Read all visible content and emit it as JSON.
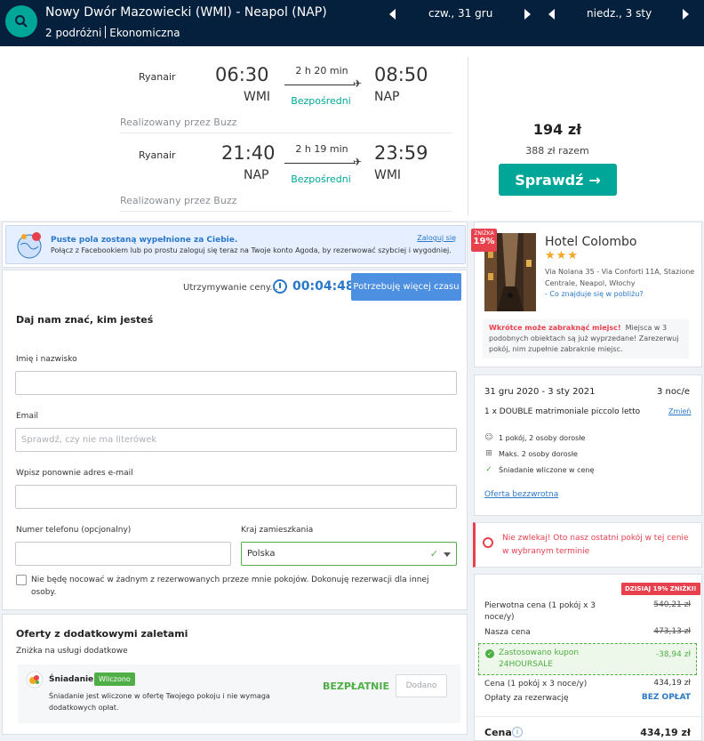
{
  "header": {
    "route": "Nowy Dwór Mazowiecki (WMI) - Neapol (NAP)",
    "travellers": "2 podróżni",
    "cabin": "Ekonomiczna",
    "outbound_date": "czw., 31 gru",
    "return_date": "niedz., 3 sty"
  },
  "flight": {
    "outbound": {
      "airline": "Ryanair",
      "dep_time": "06:30",
      "dep_code": "WMI",
      "duration": "2 h 20 min",
      "stops": "Bezpośredni",
      "arr_time": "08:50",
      "arr_code": "NAP",
      "operated_by": "Realizowany przez Buzz"
    },
    "inbound": {
      "airline": "Ryanair",
      "dep_time": "21:40",
      "dep_code": "NAP",
      "duration": "2 h 19 min",
      "stops": "Bezpośredni",
      "arr_time": "23:59",
      "arr_code": "WMI",
      "operated_by": "Realizowany przez Buzz"
    },
    "price": "194 zł",
    "price_total": "388 zł razem",
    "select_label": "Sprawdź"
  },
  "facebook": {
    "title": "Puste pola zostaną wypełnione za Ciebie.",
    "text": "Połącz z Facebookiem lub po prostu zaloguj się teraz na Twoje konto Agoda, by rezerwować szybciej i wygodniej.",
    "login": "Zaloguj się"
  },
  "timer": {
    "label": "Utrzymywanie ceny...",
    "value": "00:04:48",
    "more_time": "Potrzebuję więcej czasu"
  },
  "form": {
    "heading": "Daj nam znać, kim jesteś",
    "name_label": "Imię i nazwisko",
    "name_value": "",
    "email_label": "Email",
    "email_placeholder": "Sprawdź, czy nie ma literówek",
    "email2_label": "Wpisz ponownie adres e-mail",
    "email2_value": "",
    "phone_label": "Numer telefonu (opcjonalny)",
    "phone_value": "",
    "country_label": "Kraj zamieszkania",
    "country_value": "Polska",
    "checkbox_text": "Nie będę nocować w żadnym z rezerwowanych przeze mnie pokojów. Dokonuję rezerwacji dla innej osoby.",
    "checkbox_checked": false
  },
  "offers": {
    "heading": "Oferty z dodatkowymi zaletami",
    "sub": "Zniżka na usługi dodatkowe",
    "item_name": "Śniadanie",
    "item_badge": "Wliczono",
    "item_desc": "Śniadanie jest wliczone w ofertę Twojego pokoju i nie wymaga dodatkowych opłat.",
    "item_price": "BEZPŁATNIE",
    "item_button": "Dodano"
  },
  "hotel": {
    "discount_small": "ZNIŻKA",
    "discount": "19%",
    "name": "Hotel Colombo",
    "stars": "★★★",
    "address": "Via Nolana 35 - Via Conforti 11A, Stazione Centrale, Neapol, Włochy",
    "nearby": "- Co znajduje się w pobliżu?",
    "scarce_bold": "Wkrótce może zabraknąć miejsc!",
    "scarce_text": "Miejsca w 3 podobnych obiektach są już wyprzedane! Zarezerwuj pokój, nim zupełnie zabraknie miejsc."
  },
  "stay": {
    "dates": "31 gru 2020 - 3 sty 2021",
    "nights": "3 noc/e",
    "room": "1 x DOUBLE matrimoniale piccolo letto",
    "change": "Zmień",
    "features": [
      "1 pokój, 2 osoby dorosłe",
      "Maks. 2 osoby dorosłe",
      "Śniadanie wliczone w cenę"
    ],
    "nonref": "Oferta bezzwrotna"
  },
  "urgent": {
    "line1": "Nie zwlekaj! Oto nasz ostatni pokój w tej cenie",
    "line2": "w wybranym terminie"
  },
  "pricing": {
    "today_badge": "DZISIAJ 19% ZNIŻKI!",
    "original_label": "Pierwotna cena (1 pokój x 3 noce/y)",
    "original_value": "540,21 zł",
    "our_label": "Nasza cena",
    "our_value": "473,13 zł",
    "coupon_line1": "Zastosowano kupon",
    "coupon_line2": "24HOURSALE",
    "coupon_value": "-38,94 zł",
    "room_label": "Cena (1 pokój x 3 noce/y)",
    "room_value": "434,19 zł",
    "fee_label": "Opłaty za rezerwację",
    "fee_value": "BEZ OPŁAT",
    "total_label": "Cena",
    "total_value": "434,19 zł"
  },
  "colors": {
    "navy": "#05203c",
    "teal": "#00a698",
    "blue": "#2a78c8",
    "red": "#e8414e",
    "green": "#4fae45"
  }
}
